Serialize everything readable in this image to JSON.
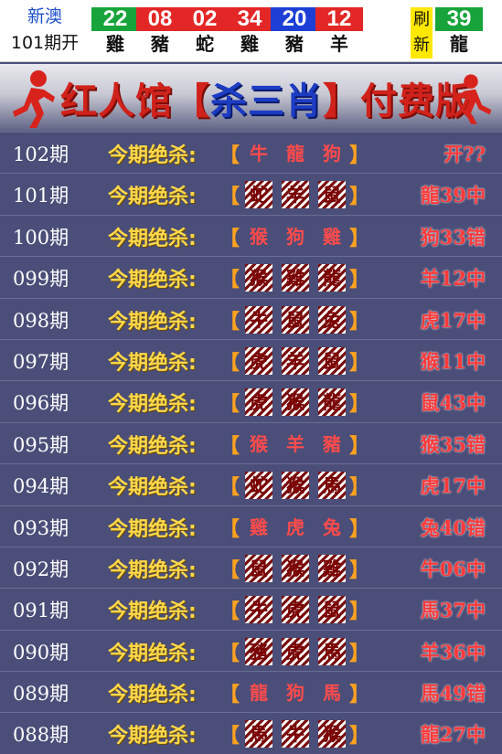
{
  "draw": {
    "region": "新澳",
    "period": "101期开",
    "balls": [
      {
        "num": "22",
        "zodiac": "雞",
        "color": "#18a43a"
      },
      {
        "num": "08",
        "zodiac": "豬",
        "color": "#e32727"
      },
      {
        "num": "02",
        "zodiac": "蛇",
        "color": "#e32727"
      },
      {
        "num": "34",
        "zodiac": "雞",
        "color": "#e32727"
      },
      {
        "num": "20",
        "zodiac": "豬",
        "color": "#1d3fd6"
      },
      {
        "num": "12",
        "zodiac": "羊",
        "color": "#e32727"
      }
    ],
    "refresh_top": "刷",
    "refresh_bottom": "新",
    "special": {
      "num": "39",
      "zodiac": "龍",
      "color": "#18a43a"
    }
  },
  "banner": {
    "title_left": "红人馆【",
    "title_mid": "杀三肖",
    "title_right": "】付费版"
  },
  "rows_label": "今期绝杀:",
  "bracket_left": "【",
  "bracket_right": "】",
  "rows": [
    {
      "period": "102期",
      "z": [
        "牛",
        "龍",
        "狗"
      ],
      "style": [
        "plain",
        "plain",
        "plain"
      ],
      "result": "开??"
    },
    {
      "period": "101期",
      "z": [
        "蛇",
        "羊",
        "鼠"
      ],
      "style": [
        "hit",
        "hit",
        "hit"
      ],
      "result": "龍39中"
    },
    {
      "period": "100期",
      "z": [
        "猴",
        "狗",
        "雞"
      ],
      "style": [
        "plain",
        "plain",
        "plain"
      ],
      "result": "狗33错"
    },
    {
      "period": "099期",
      "z": [
        "猴",
        "雞",
        "龍"
      ],
      "style": [
        "hit",
        "hit",
        "hit"
      ],
      "result": "羊12中"
    },
    {
      "period": "098期",
      "z": [
        "牛",
        "鼠",
        "兔"
      ],
      "style": [
        "hit",
        "hit",
        "hit"
      ],
      "result": "虎17中"
    },
    {
      "period": "097期",
      "z": [
        "虎",
        "羊",
        "鼠"
      ],
      "style": [
        "hit",
        "hit",
        "hit"
      ],
      "result": "猴11中"
    },
    {
      "period": "096期",
      "z": [
        "虎",
        "猴",
        "龍"
      ],
      "style": [
        "hit",
        "hit",
        "hit"
      ],
      "result": "鼠43中"
    },
    {
      "period": "095期",
      "z": [
        "猴",
        "羊",
        "豬"
      ],
      "style": [
        "plain",
        "plain",
        "plain"
      ],
      "result": "猴35错"
    },
    {
      "period": "094期",
      "z": [
        "蛇",
        "猴",
        "馬"
      ],
      "style": [
        "hit",
        "hit",
        "hit"
      ],
      "result": "虎17中"
    },
    {
      "period": "093期",
      "z": [
        "雞",
        "虎",
        "兔"
      ],
      "style": [
        "plain",
        "plain",
        "plain"
      ],
      "result": "兔40错"
    },
    {
      "period": "092期",
      "z": [
        "鼠",
        "猴",
        "雞"
      ],
      "style": [
        "hit",
        "hit",
        "hit"
      ],
      "result": "牛06中"
    },
    {
      "period": "091期",
      "z": [
        "牛",
        "虎",
        "鼠"
      ],
      "style": [
        "hit",
        "hit",
        "hit"
      ],
      "result": "馬37中"
    },
    {
      "period": "090期",
      "z": [
        "豬",
        "虎",
        "馬"
      ],
      "style": [
        "hit",
        "hit",
        "hit"
      ],
      "result": "羊36中"
    },
    {
      "period": "089期",
      "z": [
        "龍",
        "狗",
        "馬"
      ],
      "style": [
        "plain",
        "plain",
        "plain"
      ],
      "result": "馬49错"
    },
    {
      "period": "088期",
      "z": [
        "馬",
        "牛",
        "猴"
      ],
      "style": [
        "hit",
        "hit",
        "hit"
      ],
      "result": "龍27中"
    }
  ]
}
